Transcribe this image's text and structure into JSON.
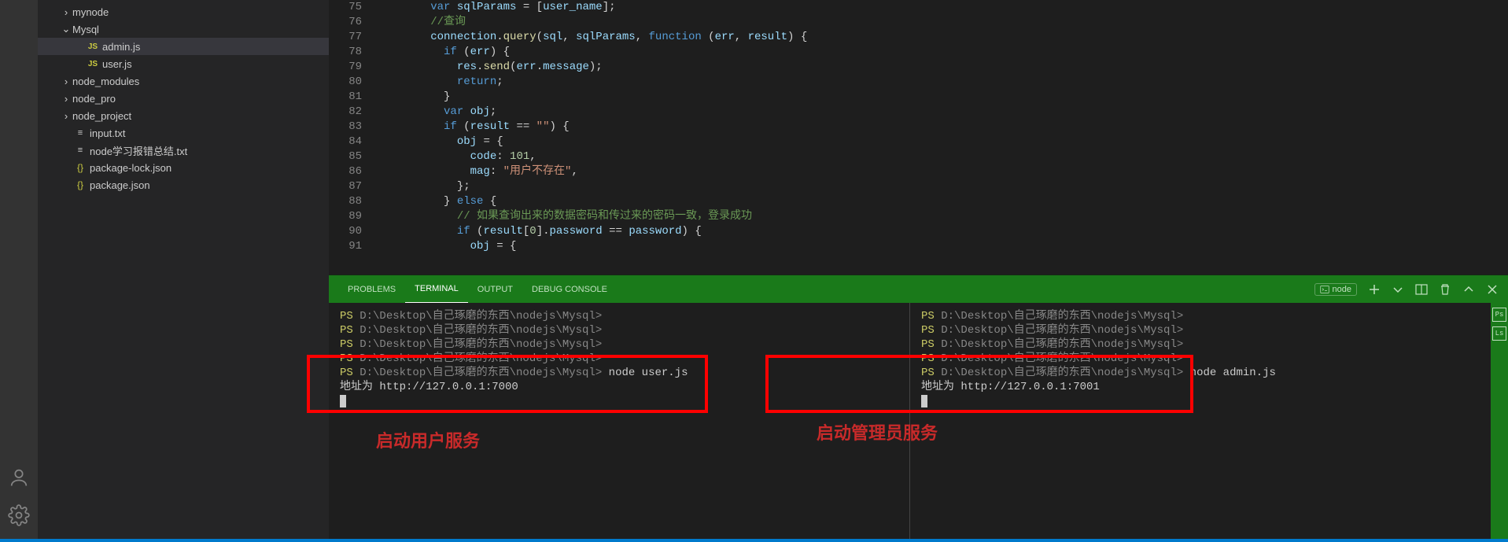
{
  "sidebar": {
    "items": [
      {
        "label": "mynode",
        "type": "folder",
        "expanded": false,
        "depth": 1
      },
      {
        "label": "Mysql",
        "type": "folder",
        "expanded": true,
        "depth": 1
      },
      {
        "label": "admin.js",
        "type": "js",
        "depth": 2,
        "active": true
      },
      {
        "label": "user.js",
        "type": "js",
        "depth": 2
      },
      {
        "label": "node_modules",
        "type": "folder",
        "expanded": false,
        "depth": 1
      },
      {
        "label": "node_pro",
        "type": "folder",
        "expanded": false,
        "depth": 1
      },
      {
        "label": "node_project",
        "type": "folder",
        "expanded": false,
        "depth": 1
      },
      {
        "label": "input.txt",
        "type": "txt",
        "depth": 1
      },
      {
        "label": "node学习报错总结.txt",
        "type": "txt",
        "depth": 1
      },
      {
        "label": "package-lock.json",
        "type": "json",
        "depth": 1
      },
      {
        "label": "package.json",
        "type": "json",
        "depth": 1
      }
    ]
  },
  "editor": {
    "startLine": 75,
    "lines": [
      {
        "n": 75,
        "html": "        <span class='kw'>var</span> <span class='var'>sqlParams</span> = [<span class='var'>user_name</span>];"
      },
      {
        "n": 76,
        "html": "        <span class='cmt'>//查询</span>"
      },
      {
        "n": 77,
        "html": "        <span class='var'>connection</span>.<span class='fn'>query</span>(<span class='var'>sql</span>, <span class='var'>sqlParams</span>, <span class='kw'>function</span> (<span class='var'>err</span>, <span class='var'>result</span>) {"
      },
      {
        "n": 78,
        "html": "          <span class='kw'>if</span> (<span class='var'>err</span>) {"
      },
      {
        "n": 79,
        "html": "            <span class='var'>res</span>.<span class='fn'>send</span>(<span class='var'>err</span>.<span class='var'>message</span>);"
      },
      {
        "n": 80,
        "html": "            <span class='kw'>return</span>;"
      },
      {
        "n": 81,
        "html": "          }"
      },
      {
        "n": 82,
        "html": "          <span class='kw'>var</span> <span class='var'>obj</span>;"
      },
      {
        "n": 83,
        "html": "          <span class='kw'>if</span> (<span class='var'>result</span> == <span class='str'>\"\"</span>) {"
      },
      {
        "n": 84,
        "html": "            <span class='var'>obj</span> = {"
      },
      {
        "n": 85,
        "html": "              <span class='var'>code</span>: <span class='num'>101</span>,"
      },
      {
        "n": 86,
        "html": "              <span class='var'>mag</span>: <span class='str'>\"用户不存在\"</span>,"
      },
      {
        "n": 87,
        "html": "            };"
      },
      {
        "n": 88,
        "html": "          } <span class='kw'>else</span> {"
      },
      {
        "n": 89,
        "html": "            <span class='cmt'>// 如果查询出来的数据密码和传过来的密码一致，登录成功</span>"
      },
      {
        "n": 90,
        "html": "            <span class='kw'>if</span> (<span class='var'>result</span>[<span class='num'>0</span>].<span class='var'>password</span> == <span class='var'>password</span>) {"
      },
      {
        "n": 91,
        "html": "              <span class='var'>obj</span> = {"
      }
    ]
  },
  "panel": {
    "tabs": {
      "problems": "PROBLEMS",
      "terminal": "TERMINAL",
      "output": "OUTPUT",
      "debug": "DEBUG CONSOLE"
    },
    "selector": "node",
    "side": {
      "a": "Ps",
      "b": "Ls"
    }
  },
  "terminals": {
    "prompt": "PS D:\\Desktop\\自己琢磨的东西\\nodejs\\Mysql>",
    "left": {
      "cmd": "node user.js",
      "out": "地址为 http://127.0.0.1:7000",
      "annotation": "启动用户服务"
    },
    "right": {
      "cmd": "node admin.js",
      "out": "地址为 http://127.0.0.1:7001",
      "annotation": "启动管理员服务"
    }
  }
}
